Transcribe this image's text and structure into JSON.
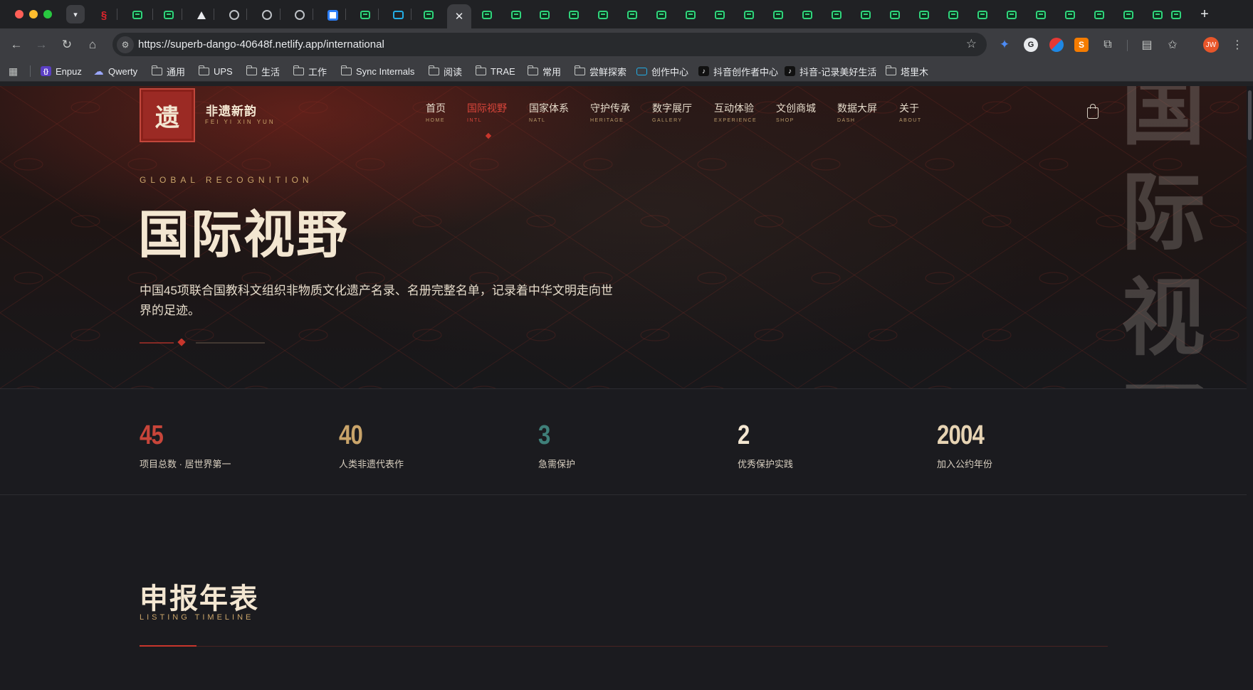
{
  "browser": {
    "url": "https://superb-dango-40648f.netlify.app/international",
    "bookmarks": [
      {
        "label": "Enpuz",
        "icon": "code-braces-icon"
      },
      {
        "label": "Qwerty",
        "icon": "cloud-icon"
      },
      {
        "label": "通用",
        "icon": "folder-icon"
      },
      {
        "label": "UPS",
        "icon": "folder-icon"
      },
      {
        "label": "生活",
        "icon": "folder-icon"
      },
      {
        "label": "工作",
        "icon": "folder-icon"
      },
      {
        "label": "Sync Internals",
        "icon": "folder-icon"
      },
      {
        "label": "阅读",
        "icon": "folder-icon"
      },
      {
        "label": "TRAE",
        "icon": "folder-icon"
      },
      {
        "label": "常用",
        "icon": "folder-icon"
      },
      {
        "label": "尝鲜探索",
        "icon": "folder-icon"
      },
      {
        "label": "创作中心",
        "icon": "bilibili-tv-icon"
      },
      {
        "label": "抖音创作者中心",
        "icon": "tiktok-icon"
      },
      {
        "label": "抖音-记录美好生活",
        "icon": "tiktok-icon"
      },
      {
        "label": "塔里木",
        "icon": "folder-icon"
      }
    ],
    "avatar_initials": "JW"
  },
  "site": {
    "logo_char": "遗",
    "logo_name": "非遗新韵",
    "logo_sub": "FEI YI XIN YUN",
    "nav": [
      {
        "cn": "首页",
        "en": "HOME"
      },
      {
        "cn": "国际视野",
        "en": "INTL"
      },
      {
        "cn": "国家体系",
        "en": "NATL"
      },
      {
        "cn": "守护传承",
        "en": "HERITAGE"
      },
      {
        "cn": "数字展厅",
        "en": "GALLERY"
      },
      {
        "cn": "互动体验",
        "en": "EXPERIENCE"
      },
      {
        "cn": "文创商城",
        "en": "SHOP"
      },
      {
        "cn": "数据大屏",
        "en": "DASH"
      },
      {
        "cn": "关于",
        "en": "ABOUT"
      }
    ],
    "active_nav": "国际视野"
  },
  "hero": {
    "eyebrow": "GLOBAL RECOGNITION",
    "title": "国际视野",
    "description": "中国45项联合国教科文组织非物质文化遗产名录、名册完整名单，记录着中华文明走向世界的足迹。",
    "vertical_title": "国际视野"
  },
  "stats": [
    {
      "value": "45",
      "label": "项目总数 · 居世界第一",
      "color": "#c8453a"
    },
    {
      "value": "40",
      "label": "人类非遗代表作",
      "color": "#c9a46a"
    },
    {
      "value": "3",
      "label": "急需保护",
      "color": "#3f7f79"
    },
    {
      "value": "2",
      "label": "优秀保护实践",
      "color": "#f3e6d1"
    },
    {
      "value": "2004",
      "label": "加入公约年份",
      "color": "#e6d3b3"
    }
  ],
  "timeline": {
    "title": "申报年表",
    "subtitle": "LISTING TIMELINE"
  }
}
